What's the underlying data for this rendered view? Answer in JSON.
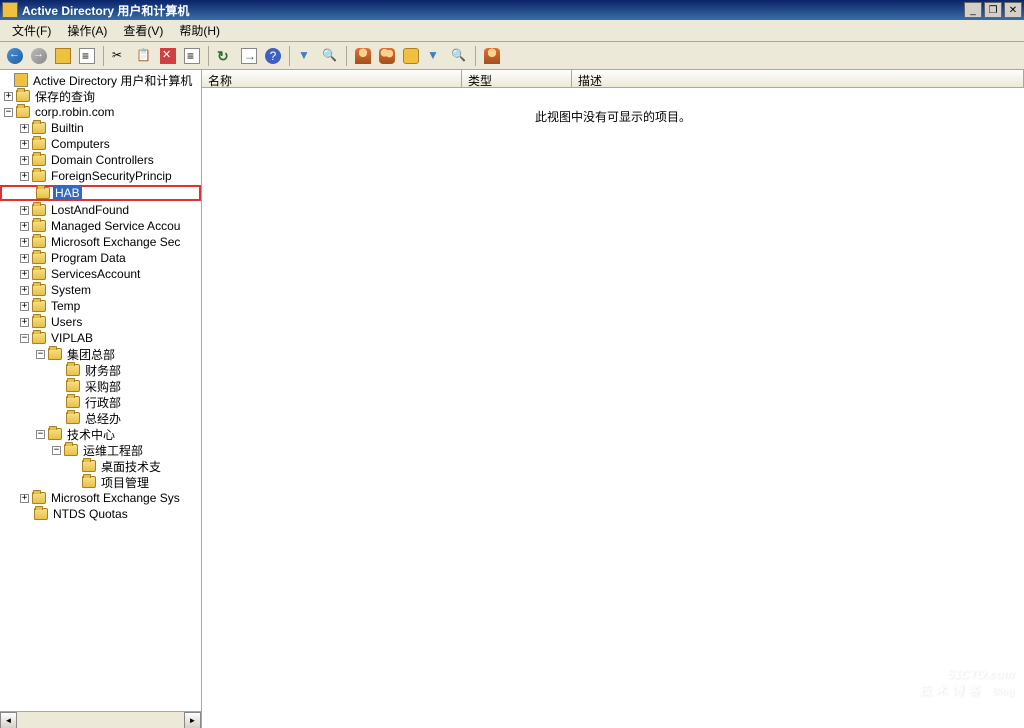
{
  "window": {
    "title": "Active Directory 用户和计算机",
    "min": "_",
    "max": "❐",
    "close": "✕"
  },
  "menu": {
    "file": "文件(F)",
    "action": "操作(A)",
    "view": "查看(V)",
    "help": "帮助(H)"
  },
  "tree": {
    "root": "Active Directory 用户和计算机",
    "saved": "保存的查询",
    "domain": "corp.robin.com",
    "nodes": {
      "builtin": "Builtin",
      "computers": "Computers",
      "dc": "Domain Controllers",
      "fsp": "ForeignSecurityPrincip",
      "hab": "HAB",
      "laf": "LostAndFound",
      "msa": "Managed Service Accou",
      "mes": "Microsoft Exchange Sec",
      "pd": "Program Data",
      "sa": "ServicesAccount",
      "sys": "System",
      "temp": "Temp",
      "users": "Users",
      "viplab": "VIPLAB",
      "mesys": "Microsoft Exchange Sys",
      "ntds": "NTDS Quotas"
    },
    "viplab": {
      "hq": "集团总部",
      "fin": "财务部",
      "pur": "采购部",
      "adm": "行政部",
      "gm": "总经办",
      "tech": "技术中心",
      "ops": "运维工程部",
      "desk": "桌面技术支",
      "proj": "项目管理"
    }
  },
  "list": {
    "col_name": "名称",
    "col_type": "类型",
    "col_desc": "描述",
    "empty": "此视图中没有可显示的项目。"
  },
  "watermark": {
    "main": "51CTO.com",
    "sub": "技术博客",
    "blog": "Blog"
  }
}
